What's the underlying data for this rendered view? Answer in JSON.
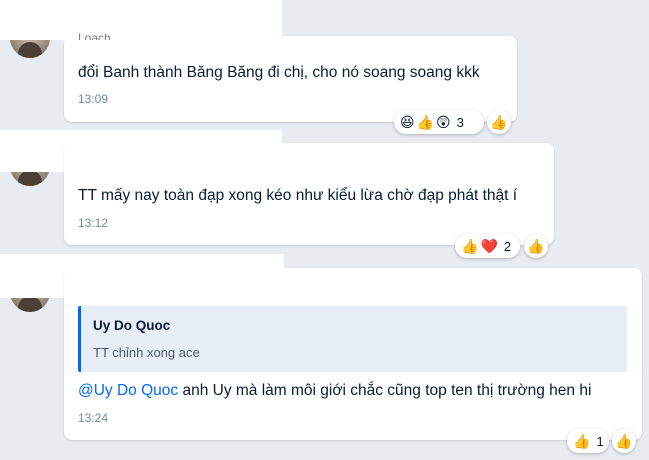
{
  "messages": [
    {
      "sender": "Loach",
      "text": "đổi Banh thành Băng Băng đi chị, cho nó soang soang kkk",
      "time": "13:09",
      "reactions": {
        "emojis": [
          "😆",
          "👍",
          "😲"
        ],
        "count": "3"
      },
      "like": "👍"
    },
    {
      "text": "TT mấy nay toàn đạp xong kéo như kiểu lừa chờ đạp phát thật í",
      "time": "13:12",
      "reactions": {
        "emojis": [
          "👍",
          "❤️"
        ],
        "count": "2"
      },
      "like": "👍"
    },
    {
      "quote": {
        "name": "Uy Do Quoc",
        "text": "TT chỉnh xong ace"
      },
      "mention": "@Uy Do Quoc",
      "text": " anh Uy mà làm môi giới chắc cũng top ten thị trường hen hi",
      "time": "13:24",
      "reactions": {
        "emojis": [
          "👍"
        ],
        "count": "1"
      },
      "like": "👍"
    }
  ]
}
